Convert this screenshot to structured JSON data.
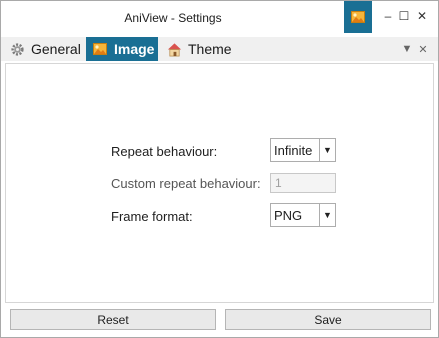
{
  "window": {
    "title": "AniView - Settings"
  },
  "titlebar": {
    "app_icon": "image-icon",
    "minimize_glyph": "–",
    "maximize_glyph": "☐",
    "close_glyph": "✕"
  },
  "tabs": [
    {
      "label": "General",
      "icon": "gear-icon",
      "active": false
    },
    {
      "label": "Image",
      "icon": "image-icon",
      "active": true
    },
    {
      "label": "Theme",
      "icon": "house-icon",
      "active": false
    }
  ],
  "tabstrip": {
    "dropdown_glyph": "▼",
    "close_glyph": "✕"
  },
  "form": {
    "repeat_behaviour": {
      "label": "Repeat behaviour:",
      "value": "Infinite"
    },
    "custom_repeat": {
      "label": "Custom repeat behaviour:",
      "value": "1"
    },
    "frame_format": {
      "label": "Frame format:",
      "value": "PNG"
    }
  },
  "buttons": {
    "reset": "Reset",
    "save": "Save"
  },
  "colors": {
    "accent": "#1a6f94"
  }
}
